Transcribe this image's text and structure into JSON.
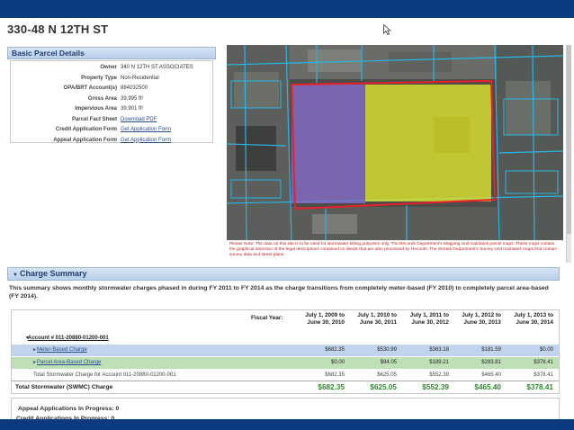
{
  "title": "330-48 N 12TH ST",
  "parcel": {
    "heading": "Basic Parcel Details",
    "rows": [
      {
        "label": "Owner",
        "value": "340 N 12TH ST ASSOCIATES"
      },
      {
        "label": "Property Type",
        "value": "Non-Residential"
      },
      {
        "label": "OPA/BRT Account(s)",
        "value": "884032500"
      },
      {
        "label": "Gross Area",
        "value": "39,995 ft²"
      },
      {
        "label": "Impervious Area",
        "value": "39,901 ft²"
      },
      {
        "label": "Parcel Fact Sheet",
        "value": "Download PDF"
      },
      {
        "label": "Credit Application Form",
        "value": "Get Application Form"
      },
      {
        "label": "Appeal Application Form",
        "value": "Get Application Form"
      }
    ]
  },
  "map": {
    "note": "Please Note: The data on this site is to be used for stormwater billing purposes only. The Records Department's Mapping Unit maintains parcel maps. These maps contain the graphical depiction of the legal descriptions contained on deeds that are also processed by Records. The Streets Department's Survey Unit maintains maps that contain survey data and street plans.",
    "colors": {
      "parcel_outline": "#e8202a",
      "impervious_purple": "#8a6fd0",
      "impervious_yellow": "#e2e82a",
      "parcel_lines": "#29b6e8"
    }
  },
  "charges": {
    "heading": "Charge Summary",
    "toggle_icon": "triangle-down-icon",
    "summary": "This summary shows monthly stormwater charges phased in during FY 2011 to FY 2014 as the charge transitions from completely meter-based (FY 2010) to completely parcel area-based (FY 2014).",
    "fiscal_label": "Fiscal Year:",
    "years": [
      {
        "l1": "July 1, 2009 to",
        "l2": "June 30, 2010"
      },
      {
        "l1": "July 1, 2010 to",
        "l2": "June 30, 2011"
      },
      {
        "l1": "July 1, 2011 to",
        "l2": "June 30, 2012"
      },
      {
        "l1": "July 1, 2012 to",
        "l2": "June 30, 2013"
      },
      {
        "l1": "July 1, 2013 to",
        "l2": "June 30, 2014"
      }
    ],
    "account_label": "Account # 011-20880-01200-001",
    "meter_label": "Meter-Based Charge",
    "meter": [
      "$682.35",
      "$530.99",
      "$363.18",
      "$181.59",
      "$0.00"
    ],
    "parcel_label": "Parcel Area-Based Charge",
    "parcel": [
      "$0.00",
      "$94.05",
      "$189.21",
      "$283.81",
      "$378.41"
    ],
    "acct_total_label": "Total Stormwater Charge for Account 011-20880-01200-001",
    "acct_total": [
      "$682.35",
      "$625.05",
      "$552.39",
      "$465.40",
      "$378.41"
    ],
    "total_label": "Total Stormwater (SWMC) Charge",
    "total": [
      "$682.35",
      "$625.05",
      "$552.39",
      "$465.40",
      "$378.41"
    ]
  },
  "appeal": {
    "in_progress": "Appeal Applications In Progress: 0",
    "second_line": "Credit Applications In Progress: 0"
  }
}
